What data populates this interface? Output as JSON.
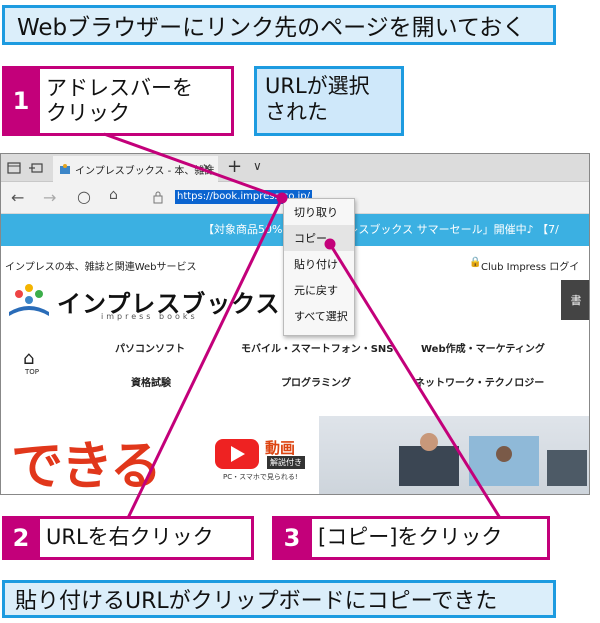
{
  "title": "Webブラウザーにリンク先のページを開いておく",
  "steps": [
    {
      "num": "1",
      "text_lines": [
        "アドレスバーを",
        "クリック"
      ]
    },
    {
      "num": "2",
      "text": "URLを右クリック"
    },
    {
      "num": "3",
      "text": "[コピー]をクリック"
    }
  ],
  "note_lines": [
    "URLが選択",
    "された"
  ],
  "result": "貼り付けるURLがクリップボードにコピーできた",
  "browser": {
    "tab_title": "インプレスブックス - 本、雑誌",
    "url": "https://book.impress.co.jp/",
    "context_menu": [
      "切り取り",
      "コピー",
      "貼り付け",
      "元に戻す",
      "すべて選択"
    ]
  },
  "website": {
    "banner": "【対象商品50%OFF】インプレスブックス サマーセール」開催中♪ 【7/",
    "tagline": "インプレスの本、雑誌と関連Webサービス",
    "club": "Club Impress ログイ",
    "logo": "インプレスブックス",
    "logo_sub": "impress books",
    "top_label": "TOP",
    "nav_row1": [
      "パソコンソフト",
      "モバイル・スマートフォン・SNS",
      "Web作成・マーケティング"
    ],
    "nav_row2": [
      "資格試験",
      "プログラミング",
      "ネットワーク・テクノロジー"
    ],
    "promo": {
      "dekiru": "できる",
      "douga": "動画",
      "kaisetsu": "解説付き",
      "pcsp": "PC・スマホで見られる!"
    }
  },
  "colors": {
    "accent_magenta": "#c3007a",
    "accent_blue": "#1d9be0",
    "box_fill": "#dbeefa",
    "selection": "#0b64d0"
  }
}
